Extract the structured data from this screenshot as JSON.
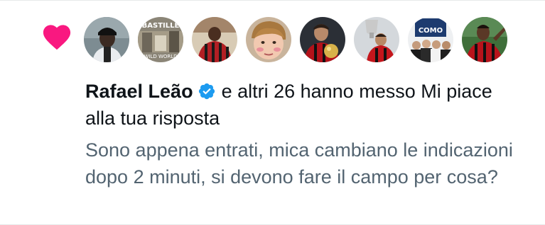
{
  "notification": {
    "user_name": "Rafael Leão",
    "action_text": "e altri 26 hanno messo Mi piace",
    "action_text_cont": "alla tua risposta",
    "reply_text": "Sono appena entrati, mica cambiano le indicazioni dopo 2 minuti, si devono fare il campo per cosa?",
    "icon": "heart-icon",
    "verified_icon": "verified-badge-icon"
  },
  "avatars": [
    {
      "name": "avatar-user-1"
    },
    {
      "name": "avatar-user-2",
      "text_top": "BASTILLE",
      "text_bottom": "WILD WORLD"
    },
    {
      "name": "avatar-user-3"
    },
    {
      "name": "avatar-user-4"
    },
    {
      "name": "avatar-user-5"
    },
    {
      "name": "avatar-user-6"
    },
    {
      "name": "avatar-user-7",
      "text": "COMO"
    },
    {
      "name": "avatar-user-8"
    }
  ],
  "colors": {
    "heart": "#f91880",
    "text": "#0f1419",
    "secondary_text": "#536471",
    "verified": "#1d9bf0"
  }
}
